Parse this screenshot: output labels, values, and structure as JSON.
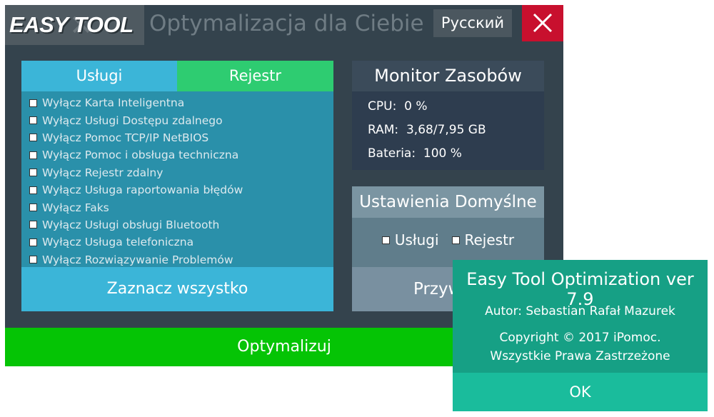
{
  "header": {
    "logo_text": "EASY TOOL",
    "title": "Optymalizacja dla Ciebie",
    "language_button": "Русский",
    "close_icon": "close-x-icon"
  },
  "services_panel": {
    "tabs": [
      "Usługi",
      "Rejestr"
    ],
    "active_tab": "Usługi",
    "options": [
      "Wyłącz Karta Inteligentna",
      "Wyłącz Usługi Dostępu zdalnego",
      "Wyłącz Pomoc TCP/IP NetBIOS",
      "Wyłącz Pomoc i obsługa techniczna",
      "Wyłącz Rejestr zdalny",
      "Wyłącz Usługa raportowania błędów",
      "Wyłącz Faks",
      "Wyłącz Usługi obsługi Bluetooth",
      "Wyłącz Usługa telefoniczna",
      "Wyłącz Rozwiązywanie Problemów"
    ],
    "select_all_button": "Zaznacz wszystko"
  },
  "monitor": {
    "title": "Monitor Zasobów",
    "cpu_label": "CPU:",
    "cpu_value": "0 %",
    "ram_label": "RAM:",
    "ram_value": "3,68/7,95 GB",
    "battery_label": "Bateria:",
    "battery_value": "100 %"
  },
  "defaults": {
    "title": "Ustawienia Domyślne",
    "options": [
      "Usługi",
      "Rejestr"
    ],
    "button_partial": "Przyw"
  },
  "optimize_button": "Optymalizuj",
  "about_dialog": {
    "title": "Easy Tool Optimization ver 7.9",
    "author": "Autor: Sebastian Rafał Mazurek",
    "copyright_line1": "Copyright © 2017 iPomoc.",
    "copyright_line2": "Wszystkie Prawa Zastrzeżone",
    "ok_button": "OK"
  },
  "colors": {
    "window_bg": "#34434d",
    "tab_services": "#3bb5d8",
    "tab_registry": "#2ecc71",
    "close_red": "#c8102e",
    "optimize_green": "#05c405",
    "dialog_teal": "#16a085"
  }
}
